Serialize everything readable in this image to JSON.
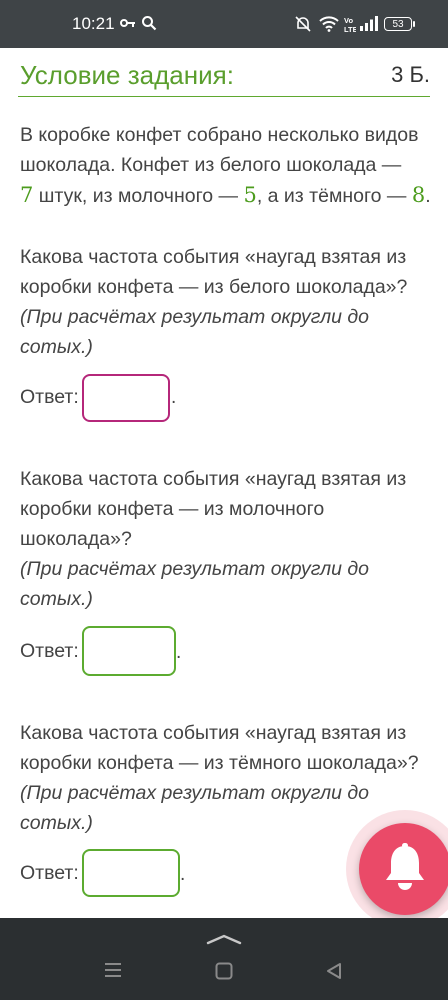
{
  "status_bar": {
    "time": "10:21",
    "battery": "53",
    "icons": [
      "key-icon",
      "search-icon",
      "mute-icon",
      "wifi-icon",
      "volte-icon",
      "signal-icon",
      "battery-icon"
    ]
  },
  "header": {
    "title": "Условие задания:",
    "points": "3 Б."
  },
  "problem": {
    "line1": "В коробке конфет собрано несколько видов",
    "line2": "шоколада. Конфет из белого шоколада —",
    "white_count": "7",
    "text_a": " штук, из молочного — ",
    "milk_count": "5",
    "text_b": ", а из тёмного — ",
    "dark_count": "8",
    "text_c": "."
  },
  "questions": [
    {
      "line1": "Какова частота события «наугад взятая из",
      "line2": "коробки конфета — из белого шоколада»?",
      "hint": "(При расчётах результат округли до сотых.)",
      "answer_label": "Ответ:",
      "answer_value": "",
      "suffix": "."
    },
    {
      "line1": "Какова частота события «наугад взятая из",
      "line2": "коробки конфета — из молочного",
      "line3": "шоколада»?",
      "hint": "(При расчётах результат округли до сотых.)",
      "answer_label": "Ответ:",
      "answer_value": "",
      "suffix": "."
    },
    {
      "line1": "Какова частота события «наугад взятая из",
      "line2": "коробки конфета — из тёмного шоколада»?",
      "hint": "(При расчётах результат округли до сотых.)",
      "answer_label": "Ответ:",
      "answer_value": "",
      "suffix": "."
    }
  ],
  "colors": {
    "accent_green": "#5a9e2d",
    "active_border": "#b5277a",
    "fab": "#ea4a68",
    "status_bar": "#3f4447",
    "nav_bar": "#2b2f31"
  }
}
